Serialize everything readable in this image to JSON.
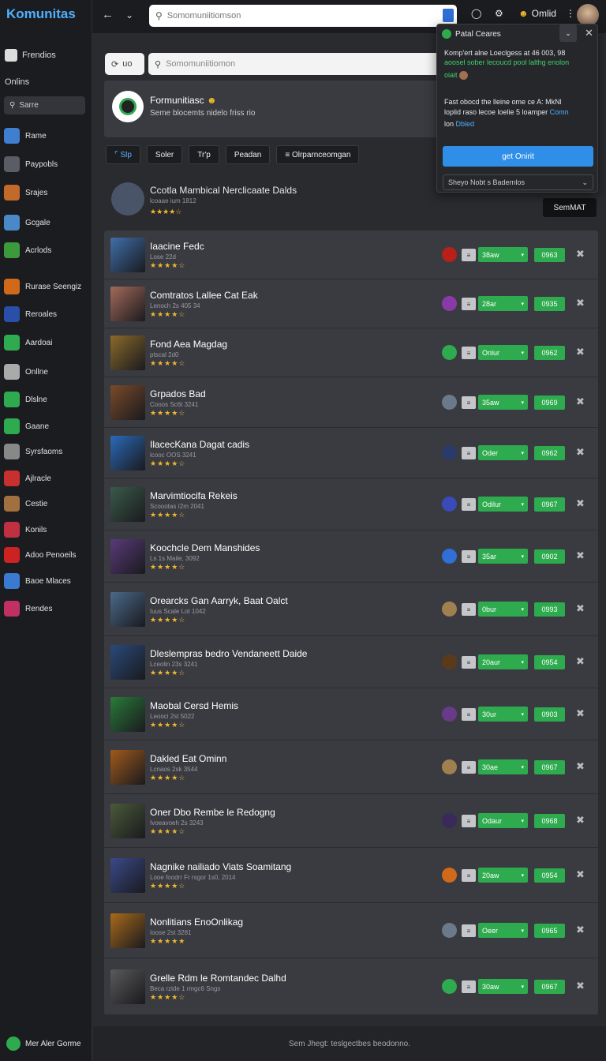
{
  "app": {
    "logo": "Komunitas"
  },
  "sidebar": {
    "section1": "Frendios",
    "section2": "Onlins",
    "search": "Sarre",
    "items": [
      {
        "label": "Rame",
        "color": "#3e7fd0"
      },
      {
        "label": "Paypobls",
        "color": "#5a5d66"
      },
      {
        "label": "Srajes",
        "color": "#c26a2a"
      },
      {
        "label": "Gcgale",
        "color": "#4a88c8"
      },
      {
        "label": "Acrlods",
        "color": "#3c9a3c"
      },
      {
        "label": "Rurase Seengiz",
        "color": "#d06a1a"
      },
      {
        "label": "Reroales",
        "color": "#2a4fa8"
      },
      {
        "label": "Aardoai",
        "color": "#2eaa4f"
      },
      {
        "label": "Onllne",
        "color": "#aaaaaa"
      },
      {
        "label": "Dlslne",
        "color": "#2eaa4f"
      },
      {
        "label": "Gaane",
        "color": "#2eaa4f"
      },
      {
        "label": "Syrsfaoms",
        "color": "#888888"
      },
      {
        "label": "Ajlracle",
        "color": "#c83030"
      },
      {
        "label": "Cestie",
        "color": "#a07040"
      },
      {
        "label": "Konils",
        "color": "#c03040"
      },
      {
        "label": "Adoo Penoeils",
        "color": "#cc2222"
      },
      {
        "label": "Baoe Mlaces",
        "color": "#3a7ad0"
      },
      {
        "label": "Rendes",
        "color": "#c03060"
      }
    ],
    "bottom": "Mer Aler Gorme"
  },
  "topbar": {
    "search_placeholder": "Somomuniitiomson",
    "user_label": "Omlid"
  },
  "main": {
    "search_placeholder": "Somomuniitiomon",
    "left_pill": "uo",
    "header": {
      "title": "Formunitiasc",
      "subtitle": "Seme blocemts nidelo friss rio"
    },
    "filters": [
      "Slp",
      "Soler",
      "Tr'p",
      "Peadan",
      "Olrparnceomgan"
    ],
    "featured": {
      "title": "Ccotla Mambical Nerclicaate Dalds",
      "sub": "lcoaae ium 1812",
      "stars": "★★★★☆",
      "button": "SemMAT"
    }
  },
  "rows": [
    {
      "title": "Iaacine Fedc",
      "sub": "Lose 22d",
      "stars": "★★★★☆",
      "select": "38aw",
      "price": "0963",
      "thumb": "#3f6fa8",
      "icon": "#b8201a"
    },
    {
      "title": "Comtratos Lallee Cat Eak",
      "sub": "Lenoch 2s 405 34",
      "stars": "★★★★☆",
      "select": "28ar",
      "price": "0935",
      "thumb": "#a46a5a",
      "icon": "#8a3aa8"
    },
    {
      "title": "Fond Aea Magdag",
      "sub": "ptscal 2d0",
      "stars": "★★★★☆",
      "select": "Onlur",
      "price": "0962",
      "thumb": "#8a6a2a",
      "icon": "#2eaa4f"
    },
    {
      "title": "Grpados Bad",
      "sub": "Cooos Sc6t 3241",
      "stars": "★★★★☆",
      "select": "35aw",
      "price": "0969",
      "thumb": "#7a4a2a",
      "icon": "#6a7a8a"
    },
    {
      "title": "IlacecKana Dagat cadis",
      "sub": "lcooc OOS 3241",
      "stars": "★★★★☆",
      "select": "Oder",
      "price": "0962",
      "thumb": "#2a6ab8",
      "icon": "#2a3a6a"
    },
    {
      "title": "Marvimtiocifa Rekeis",
      "sub": "Scoootas I2m 2041",
      "stars": "★★★★☆",
      "select": "Odilur",
      "price": "0967",
      "thumb": "#3a5a4a",
      "icon": "#3a4ab8"
    },
    {
      "title": "Koochcle Dem Manshides",
      "sub": "Ls 1s Maile, 3092",
      "stars": "★★★★☆",
      "select": "35ar",
      "price": "0902",
      "thumb": "#5a3a7a",
      "icon": "#2f6fd6"
    },
    {
      "title": "Orearcks Gan Aarryk, Baat Oalct",
      "sub": "Iuus Scale Lot 1042",
      "stars": "★★★★☆",
      "select": "0bur",
      "price": "0993",
      "thumb": "#4a6a8a",
      "icon": "#a08050"
    },
    {
      "title": "Dleslempras bedro Vendaneett Daide",
      "sub": "Lceolin 23s 3241",
      "stars": "★★★★☆",
      "select": "20aur",
      "price": "0954",
      "thumb": "#2a4a7a",
      "icon": "#5a3a1a"
    },
    {
      "title": "Maobal Cersd Hemis",
      "sub": "Leooci 2st 5022",
      "stars": "★★★★☆",
      "select": "30ur",
      "price": "0903",
      "thumb": "#2a7a3a",
      "icon": "#6a3a8a"
    },
    {
      "title": "Dakled Eat Ominn",
      "sub": "Lcnaos 2sk 3544",
      "stars": "★★★★☆",
      "select": "30ae",
      "price": "0967",
      "thumb": "#a05a1a",
      "icon": "#a08050"
    },
    {
      "title": "Oner Dbo Rembe le Redogng",
      "sub": "Ivoeavoeh 2s 3243",
      "stars": "★★★★☆",
      "select": "Odaur",
      "price": "0968",
      "thumb": "#4a5a3a",
      "icon": "#3a2a5a"
    },
    {
      "title": "Nagnike nailiado Viats Soamitang",
      "sub": "Looe foodrr Fr rsgor 1s0, 2014",
      "stars": "★★★★☆",
      "select": "20aw",
      "price": "0954",
      "thumb": "#3a4a8a",
      "icon": "#d06a1a"
    },
    {
      "title": "Nonlitians EnoOnlikag",
      "sub": "Ioose 2st 3281",
      "stars": "★★★★★",
      "select": "Oeer",
      "price": "0965",
      "thumb": "#a86a1a",
      "icon": "#6a7a8a"
    },
    {
      "title": "Grelle Rdm le Romtandec Dalhd",
      "sub": "Beca rzide 1 rmgc6 Sngs",
      "stars": "★★★★☆",
      "select": "30aw",
      "price": "0967",
      "thumb": "#5a5a5a",
      "icon": "#2eaa4f"
    }
  ],
  "popup": {
    "title": "Patal Ceares",
    "line1": "Komp'ert alne Loeclgess at 46 003, 98",
    "line2": "aoosel sober lecoucd pool lalthg enolon",
    "line3": "oiait",
    "line4": "Fast obocd the lleine ome ce A: MkNl",
    "line5": "loplid raso lecoe loelie 5 loamper",
    "link1": "Comn",
    "line6": "lon",
    "link2": "Dbled",
    "button": "get Onirit",
    "select": "Sheyo Nobt s Badernlos"
  },
  "footer": {
    "text": "Sem Jhegt: teslgectbes beodonno."
  }
}
